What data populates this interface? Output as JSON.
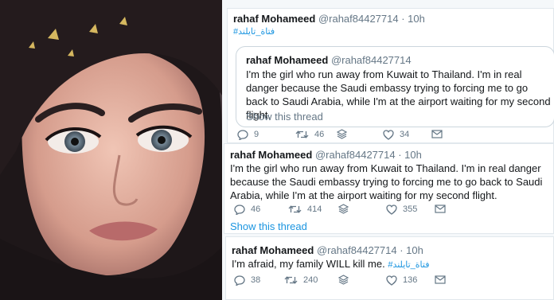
{
  "tweets": [
    {
      "name": "rahaf Mohameed",
      "handle": "@rahaf84427714",
      "time": "· 10h",
      "hashtag": "#فتاة_تايلند",
      "quoted": {
        "name": "rahaf Mohameed",
        "handle": "@rahaf84427714",
        "text": "I'm the girl who run away from Kuwait to Thailand. I'm in real danger because the Saudi embassy trying to forcing me to go back to Saudi Arabia, while I'm at the airport waiting for my second flight.",
        "show_thread": "Show this thread"
      },
      "replies": "9",
      "retweets": "46",
      "likes": "34"
    },
    {
      "name": "rahaf Mohameed",
      "handle": "@rahaf84427714",
      "time": "· 10h",
      "text": "I'm the girl who run away from Kuwait to Thailand. I'm in real danger because the Saudi embassy trying to forcing me to go back to Saudi Arabia, while I'm at the airport waiting for my second flight.",
      "replies": "46",
      "retweets": "414",
      "likes": "355",
      "show_thread": "Show this thread"
    },
    {
      "name": "rahaf Mohameed",
      "handle": "@rahaf84427714",
      "time": "· 10h",
      "text": "I'm afraid, my family WILL kill me.",
      "hashtag": "#فتاة_تايلند",
      "replies": "38",
      "retweets": "240",
      "likes": "136"
    }
  ],
  "icons": {
    "reply": "speech-bubble-outline",
    "retweet": "retweet-arrows",
    "share": "stack-layers",
    "like": "heart-outline",
    "dm": "envelope-outline"
  },
  "colors": {
    "link_blue": "#1b95e0",
    "muted_gray": "#657786",
    "text_dark": "#14171a",
    "border": "#e1e8ed"
  }
}
